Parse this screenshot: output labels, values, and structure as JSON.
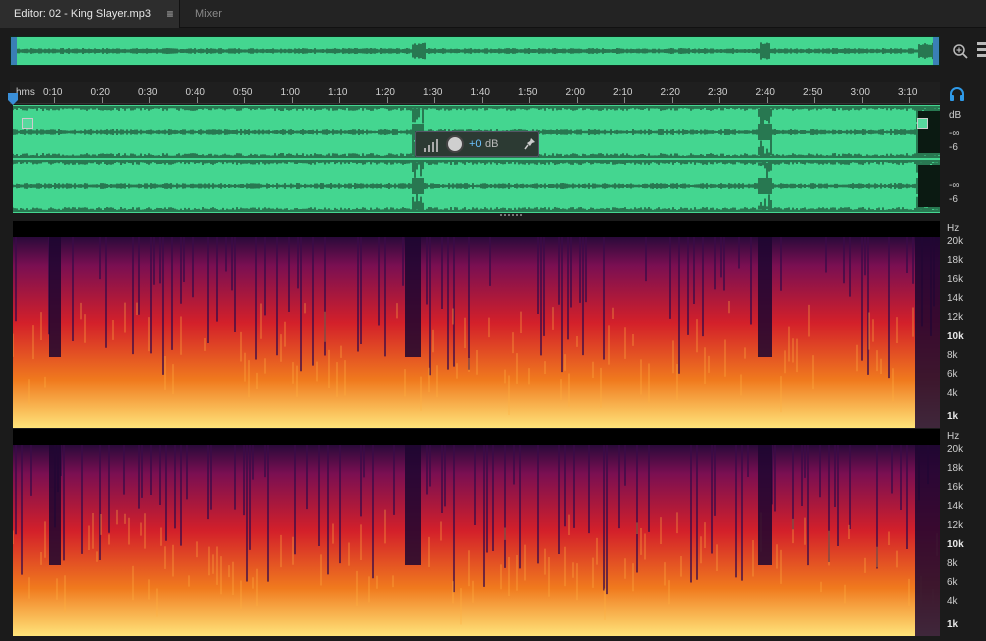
{
  "tabs": {
    "editor_label": "Editor: 02 - King Slayer.mp3",
    "menu_glyph": "≡",
    "mixer_label": "Mixer"
  },
  "ruler": {
    "unit": "hms",
    "ticks": [
      "0:10",
      "0:20",
      "0:30",
      "0:40",
      "0:50",
      "1:00",
      "1:10",
      "1:20",
      "1:30",
      "1:40",
      "1:50",
      "2:00",
      "2:10",
      "2:20",
      "2:30",
      "2:40",
      "2:50",
      "3:00",
      "3:10"
    ]
  },
  "waveform": {
    "db_labels": [
      "dB",
      "-∞",
      "-6",
      "-∞",
      "-6"
    ],
    "hud_value": "+0",
    "hud_unit": "dB"
  },
  "spectral": {
    "hz_labels_top": [
      "Hz",
      "20k",
      "18k",
      "16k",
      "14k",
      "12k",
      "10k",
      "8k",
      "6k",
      "4k",
      "1k"
    ],
    "hz_labels_bottom": [
      "Hz",
      "20k",
      "18k",
      "16k",
      "14k",
      "12k",
      "10k",
      "8k",
      "6k",
      "4k",
      "1k"
    ]
  },
  "colors": {
    "wave_bg": "#44d690",
    "wave_line": "#0b1a12",
    "accent_blue": "#3a7fb5",
    "hud_value": "#6cc3ff"
  },
  "icons": {
    "zoom": "zoom-in-icon",
    "headphones": "headphones-icon",
    "pin": "pin-icon",
    "knob": "volume-knob-icon"
  }
}
